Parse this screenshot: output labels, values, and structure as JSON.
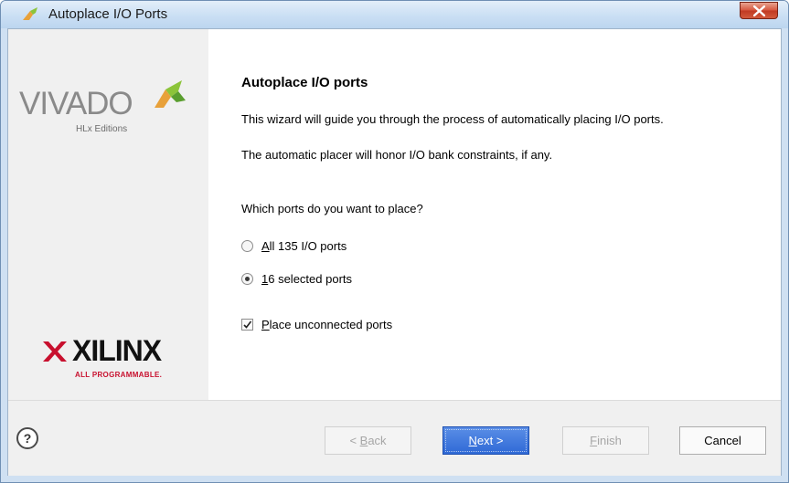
{
  "window": {
    "title": "Autoplace I/O Ports",
    "close_icon": "close-icon"
  },
  "branding": {
    "vivado": "VIVADO",
    "vivado_sub": "HLx Editions",
    "xilinx": "XILINX",
    "xilinx_sub": "ALL PROGRAMMABLE."
  },
  "page": {
    "heading": "Autoplace I/O ports",
    "description": "This wizard will guide you through the process of automatically placing I/O ports.",
    "note": "The automatic placer will honor I/O bank constraints, if any.",
    "question": "Which ports do you want to place?"
  },
  "options": {
    "all_ports": {
      "mnemonic": "A",
      "rest": "ll 135 I/O ports",
      "checked": false
    },
    "selected_ports": {
      "mnemonic": "1",
      "rest": "6 selected ports",
      "checked": true
    },
    "unconnected": {
      "mnemonic": "P",
      "rest": "lace unconnected ports",
      "checked": true
    }
  },
  "footer": {
    "help": "?",
    "back": {
      "prefix": "< ",
      "mnemonic": "B",
      "rest": "ack",
      "enabled": false
    },
    "next": {
      "mnemonic": "N",
      "rest": "ext >",
      "enabled": true
    },
    "finish": {
      "mnemonic": "F",
      "rest": "inish",
      "enabled": false
    },
    "cancel": "Cancel"
  },
  "colors": {
    "accent": "#2f69d6",
    "xilinx_red": "#c8102e",
    "vivado_orange": "#e8a13a"
  }
}
